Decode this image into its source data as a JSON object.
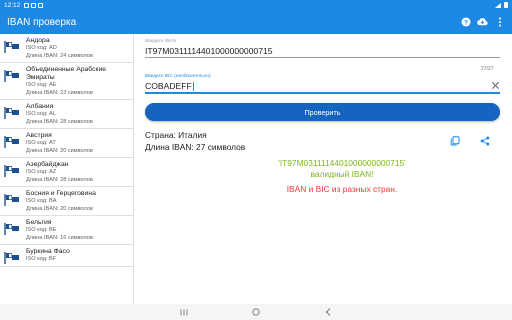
{
  "status_bar": {
    "time": "12:12"
  },
  "app_bar": {
    "title": "IBAN проверка"
  },
  "countries": [
    {
      "name": "Андора",
      "iso": "ISO код: AD",
      "length": "Длина IBAN: 24 символов"
    },
    {
      "name": "Объединенные Арабские Эмираты",
      "iso": "ISO код: AE",
      "length": "Длина IBAN: 23 символов"
    },
    {
      "name": "Албания",
      "iso": "ISO код: AL",
      "length": "Длина IBAN: 28 символов"
    },
    {
      "name": "Австрия",
      "iso": "ISO код: AT",
      "length": "Длина IBAN: 20 символов"
    },
    {
      "name": "Азербайджан",
      "iso": "ISO код: AZ",
      "length": "Длина IBAN: 28 символов"
    },
    {
      "name": "Босния и Герцеговина",
      "iso": "ISO код: BA",
      "length": "Длина IBAN: 20 символов"
    },
    {
      "name": "Бельгия",
      "iso": "ISO код: BE",
      "length": "Длина IBAN: 16 символов"
    },
    {
      "name": "Буркина Фасо",
      "iso": "ISO код: BF",
      "length": ""
    }
  ],
  "iban_field": {
    "label": "Введите IBAN",
    "value": "IT97M0311114401000000000715",
    "counter": "27/27"
  },
  "bic_field": {
    "label": "Введите BIC (необязательно)",
    "value": "COBADEFF"
  },
  "check_button": "Проверить",
  "result": {
    "country": "Страна: Италия",
    "length": "Длина IBAN: 27 символов",
    "iban_quoted": "'IT97M0311114401000000000715'",
    "valid_text": "валидный IBAN!",
    "mismatch_text": "IBAN и BIC из разных стран."
  },
  "colors": {
    "primary": "#1e88e5",
    "button": "#1565c0",
    "valid": "#7cb518",
    "error": "#e53935"
  }
}
